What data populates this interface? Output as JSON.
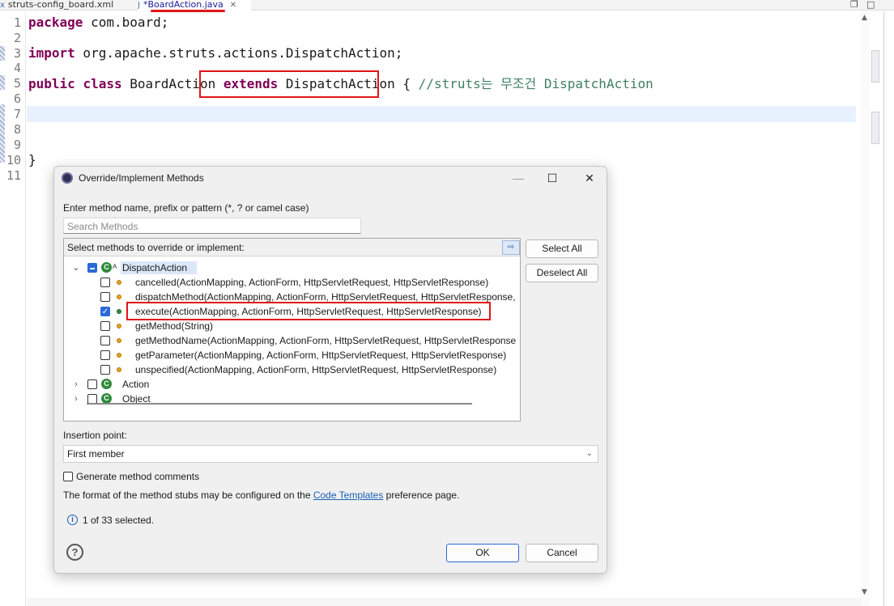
{
  "tabs": [
    {
      "label": "struts-config_board.xml",
      "icon": "xml-file-icon"
    },
    {
      "label": "*BoardAction.java",
      "icon": "java-file-icon",
      "active": true
    }
  ],
  "window_controls": {
    "restore": "❐",
    "maximize": "□"
  },
  "editor": {
    "line_numbers": [
      "1",
      "2",
      "3",
      "4",
      "5",
      "6",
      "7",
      "8",
      "9",
      "10",
      "11"
    ],
    "code": {
      "line1": {
        "kw": "package",
        "rest": " com.board;"
      },
      "line3": {
        "kw": "import",
        "rest": " org.apache.struts.actions.DispatchAction;"
      },
      "line5": {
        "kw1": "public",
        "kw2": "class",
        "cls": " BoardAction ",
        "kw3": "extends",
        "parent": " DispatchAction { ",
        "comment": "//struts는 무조건 DispatchAction"
      },
      "line10": "}"
    }
  },
  "dialog": {
    "title": "Override/Implement Methods",
    "controls": {
      "minimize": "—",
      "maximize": "☐",
      "close": "✕"
    },
    "filter_label": "Enter method name, prefix or pattern (*, ? or camel case)",
    "search_placeholder": "Search Methods",
    "tree_label": "Select methods to override or implement:",
    "expand_icon": "⇨",
    "tree": {
      "root": {
        "label": "DispatchAction",
        "sup": "A",
        "state": "partial"
      },
      "methods": [
        {
          "label": "cancelled(ActionMapping, ActionForm, HttpServletRequest, HttpServletResponse)",
          "checked": false
        },
        {
          "label": "dispatchMethod(ActionMapping, ActionForm, HttpServletRequest, HttpServletResponse,",
          "checked": false
        },
        {
          "label": "execute(ActionMapping, ActionForm, HttpServletRequest, HttpServletResponse)",
          "checked": true
        },
        {
          "label": "getMethod(String)",
          "checked": false
        },
        {
          "label": "getMethodName(ActionMapping, ActionForm, HttpServletRequest, HttpServletResponse",
          "checked": false
        },
        {
          "label": "getParameter(ActionMapping, ActionForm, HttpServletRequest, HttpServletResponse)",
          "checked": false
        },
        {
          "label": "unspecified(ActionMapping, ActionForm, HttpServletRequest, HttpServletResponse)",
          "checked": false
        }
      ],
      "others": [
        {
          "label": "Action",
          "checked": false
        },
        {
          "label": "Object",
          "checked": false
        }
      ]
    },
    "buttons": {
      "select_all": "Select All",
      "deselect_all": "Deselect All",
      "ok": "OK",
      "cancel": "Cancel"
    },
    "insertion_label": "Insertion point:",
    "insertion_value": "First member",
    "generate_comments": "Generate method comments",
    "format_note_pre": "The format of the method stubs may be configured on the ",
    "format_note_link": "Code Templates",
    "format_note_post": " preference page.",
    "status": "1 of 33 selected.",
    "help_icon": "?",
    "info_icon": "i"
  },
  "colors": {
    "keyword": "#7f0055",
    "comment": "#3f7f5f",
    "highlight": "#e01515",
    "accent": "#2a6ad8"
  }
}
